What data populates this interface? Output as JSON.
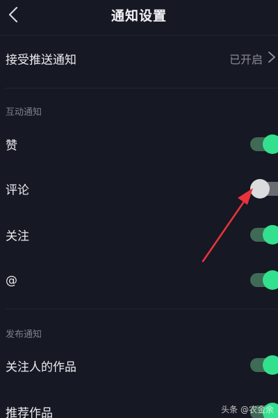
{
  "header": {
    "title": "通知设置",
    "back_icon": "chevron-left-icon"
  },
  "push": {
    "label": "接受推送通知",
    "value": "已开启",
    "chevron_icon": "chevron-right-icon"
  },
  "interaction": {
    "section_title": "互动通知",
    "items": [
      {
        "label": "赞",
        "enabled": true
      },
      {
        "label": "评论",
        "enabled": false
      },
      {
        "label": "关注",
        "enabled": true
      },
      {
        "label": "@",
        "enabled": true
      }
    ]
  },
  "publish": {
    "section_title": "发布通知",
    "items": [
      {
        "label": "关注人的作品",
        "enabled": true
      },
      {
        "label": "推荐作品",
        "enabled": true
      }
    ]
  },
  "watermark": "头条 @农金余",
  "colors": {
    "background": "#161823",
    "toggle_on_knob": "#33e08d",
    "toggle_on_track": "#3f6a55",
    "toggle_off_knob": "#dcdcdf",
    "toggle_off_track": "#6b6c72",
    "annotation_arrow": "#e8333b"
  }
}
